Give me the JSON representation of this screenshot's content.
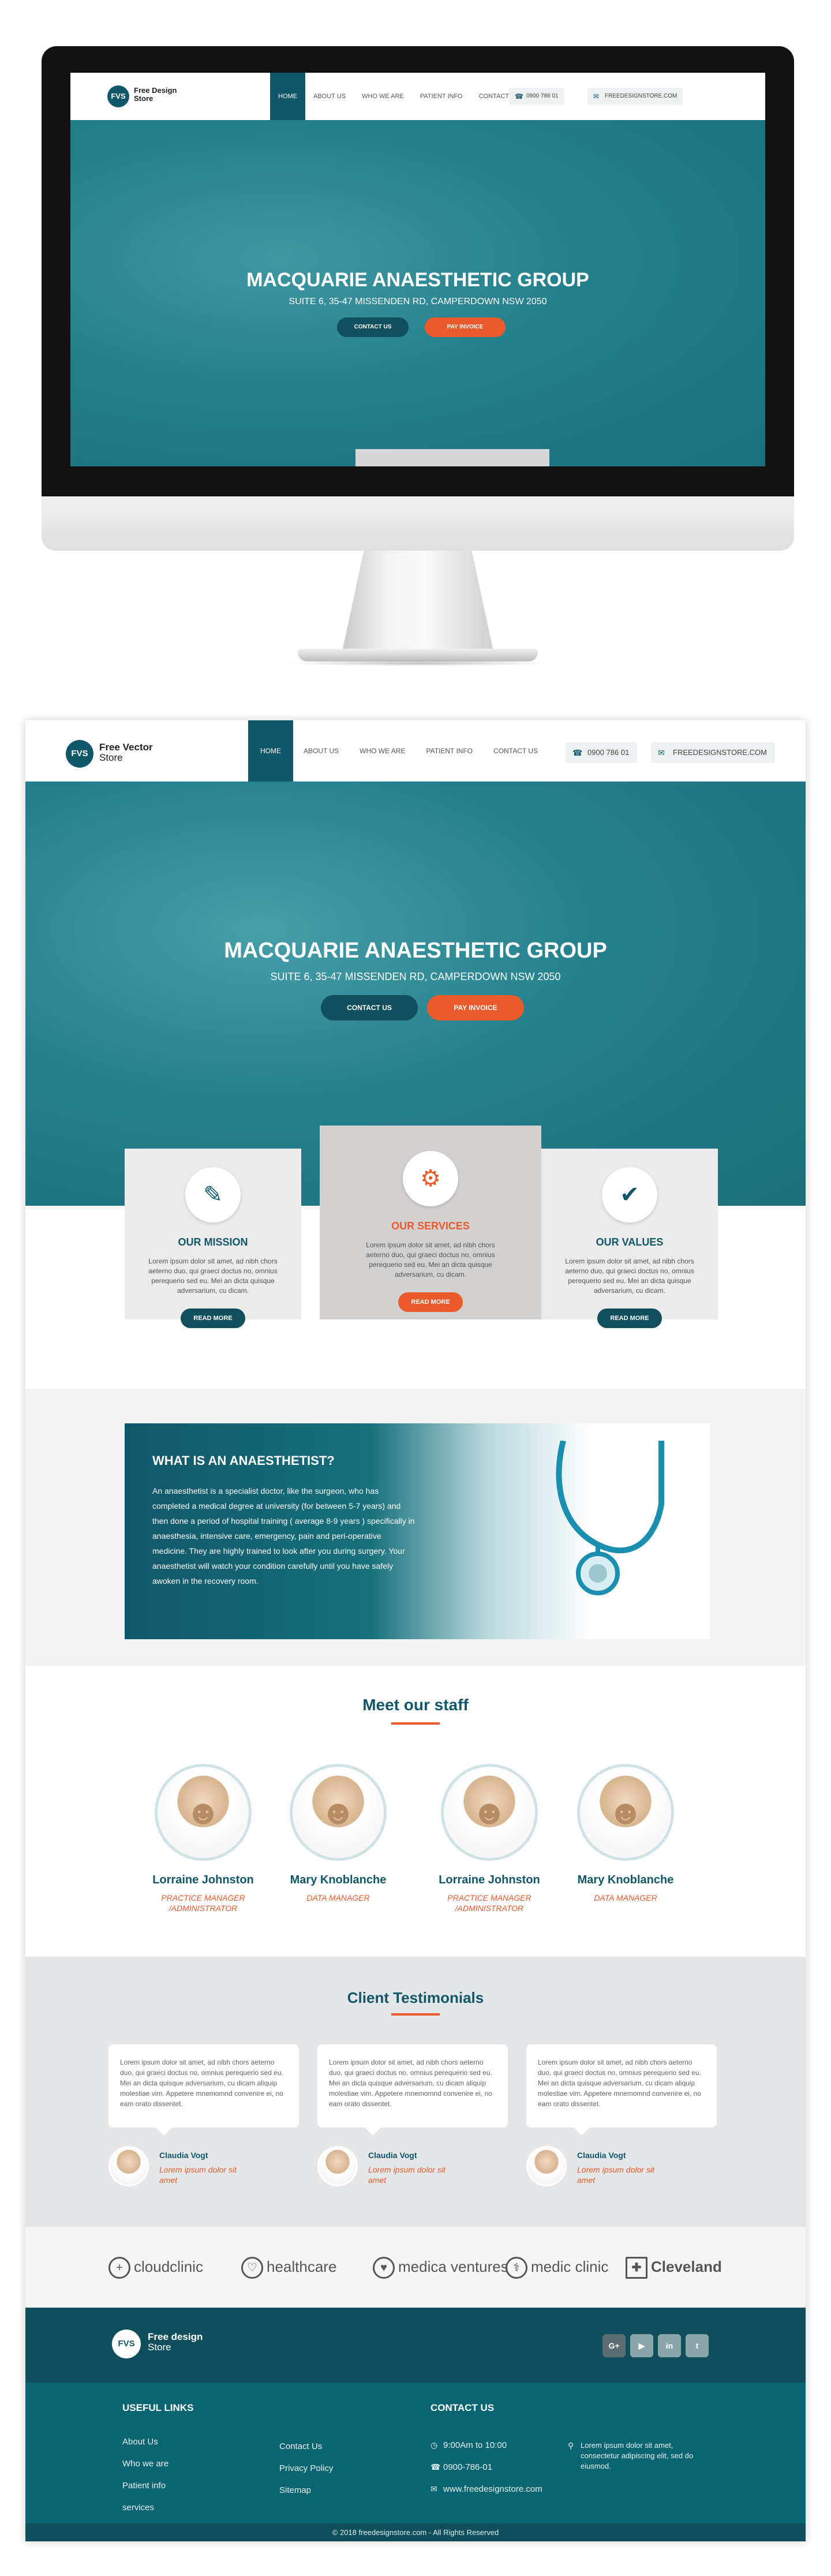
{
  "brand": {
    "logo_mark": "FVS",
    "monitor_name_line1": "Free Design",
    "monitor_name_line2": "Store",
    "name_line1": "Free Vector",
    "name_line2": "Store"
  },
  "nav": {
    "items": [
      "HOME",
      "ABOUT US",
      "WHO WE ARE",
      "PATIENT INFO",
      "CONTACT US"
    ],
    "phone": "0900 786 01",
    "email": "FREEDESIGNSTORE.COM"
  },
  "hero": {
    "title": "MACQUARIE ANAESTHETIC GROUP",
    "subtitle": "SUITE 6, 35-47 MISSENDEN RD, CAMPERDOWN NSW 2050",
    "contact_button": "CONTACT US",
    "pay_button": "PAY INVOICE"
  },
  "cards": [
    {
      "title": "OUR MISSION",
      "body": "Lorem ipsum dolor sit amet, ad nibh chors aeterno duo, qui graeci doctus no, omnius perequerio sed eu. Mei an dicta quisque adversarium, cu dicam.",
      "button": "READ MORE",
      "icon": "document-pen-icon"
    },
    {
      "title": "OUR SERVICES",
      "body": "Lorem ipsum dolor sit amet, ad nibh chors aeterno duo, qui graeci doctus no, omnius perequerio sed eu. Mei an dicta quisque adversarium, cu dicam.",
      "button": "READ MORE",
      "icon": "gear-hands-icon"
    },
    {
      "title": "OUR VALUES",
      "body": "Lorem ipsum dolor sit amet, ad nibh chors aeterno duo, qui graeci doctus no, omnius perequerio sed eu. Mei an dicta quisque adversarium, cu dicam.",
      "button": "READ MORE",
      "icon": "check-badge-icon"
    }
  ],
  "about": {
    "title": "WHAT IS AN ANAESTHETIST?",
    "text": "An anaesthetist is a specialist doctor, like the surgeon, who has completed a medical degree at university (for between 5-7 years) and then done a period of hospital training ( average 8-9 years ) specifically in anaesthesia, intensive care, emergency, pain and peri-operative medicine. They are highly trained to look after you during surgery. Your anaesthetist will watch your condition carefully until you have safely awoken in the recovery room."
  },
  "staff": {
    "title": "Meet our staff",
    "members": [
      {
        "name": "Lorraine Johnston",
        "role": "PRACTICE MANAGER /ADMINISTRATOR"
      },
      {
        "name": "Mary Knoblanche",
        "role": "DATA MANAGER"
      },
      {
        "name": "Lorraine Johnston",
        "role": "PRACTICE MANAGER /ADMINISTRATOR"
      },
      {
        "name": "Mary Knoblanche",
        "role": "DATA MANAGER"
      }
    ]
  },
  "testimonials": {
    "title": "Client Testimonials",
    "items": [
      {
        "text": "Lorem ipsum dolor sit amet, ad nibh chors aeterno duo, qui graeci doctus no, omnius perequerio sed eu. Mei an dicta quisque adversarium, cu dicam aliquip molestiae vim. Appetere mnemomnd convenire ei, no eam orato dissentet.",
        "name": "Claudia Vogt",
        "quote": "Lorem ipsum dolor sit amet"
      },
      {
        "text": "Lorem ipsum dolor sit amet, ad nibh chors aeterno duo, qui graeci doctus no, omnius perequerio sed eu. Mei an dicta quisque adversarium, cu dicam aliquip molestiae vim. Appetere mnemomnd convenire ei, no eam orato dissentet.",
        "name": "Claudia Vogt",
        "quote": "Lorem ipsum dolor sit amet"
      },
      {
        "text": "Lorem ipsum dolor sit amet, ad nibh chors aeterno duo, qui graeci doctus no, omnius perequerio sed eu. Mei an dicta quisque adversarium, cu dicam aliquip molestiae vim. Appetere mnemomnd convenire ei, no eam orato dissentet.",
        "name": "Claudia Vogt",
        "quote": "Lorem ipsum dolor sit amet"
      }
    ]
  },
  "partners": [
    "cloudclinic",
    "healthcare",
    "medica ventures",
    "medic clinic",
    "Cleveland"
  ],
  "footer": {
    "logo_line1": "Free design",
    "logo_line2": "Store",
    "social": [
      "G+",
      "▶",
      "in",
      "t"
    ],
    "useful_links_title": "USEFUL LINKS",
    "links_col1": [
      "About Us",
      "Who we are",
      "Patient info",
      "services"
    ],
    "links_col2": [
      "Contact Us",
      "Privacy Policy",
      "Sitemap"
    ],
    "contact_title": "CONTACT US",
    "hours": "9:00Am to 10:00",
    "phone": "0900-786-01",
    "website": "www.freedesignstore.com",
    "address": "Lorem ipsum dolor sit amet, consectetur adipiscing elit, sed do eiusmod.",
    "copyright": "© 2018 freedesignstore.com - All Rights Reserved"
  },
  "colors": {
    "primary": "#11576a",
    "accent": "#ea5a2a",
    "hero": "#1f7f8c",
    "footer": "#0a6572"
  }
}
